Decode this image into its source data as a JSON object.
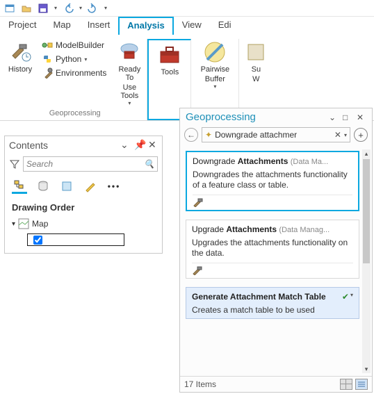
{
  "qat": {
    "items": [
      "new-project",
      "open",
      "save",
      "undo",
      "redo"
    ]
  },
  "ribbon": {
    "tabs": [
      {
        "id": "project",
        "label": "Project"
      },
      {
        "id": "map",
        "label": "Map"
      },
      {
        "id": "insert",
        "label": "Insert"
      },
      {
        "id": "analysis",
        "label": "Analysis",
        "active": true
      },
      {
        "id": "view",
        "label": "View"
      },
      {
        "id": "edit",
        "label": "Edi"
      }
    ],
    "group_label": "Geoprocessing",
    "history_label": "History",
    "modelbuilder_label": "ModelBuilder",
    "python_label": "Python",
    "environments_label": "Environments",
    "ready_label_line1": "Ready To",
    "ready_label_line2": "Use Tools",
    "tools_label": "Tools",
    "pairwise_line1": "Pairwise",
    "pairwise_line2": "Buffer",
    "sum_line1": "Su",
    "sum_line2": "W"
  },
  "contents": {
    "title": "Contents",
    "search_placeholder": "Search",
    "section": "Drawing Order",
    "map_label": "Map"
  },
  "gp": {
    "title": "Geoprocessing",
    "search_text": "Downgrade attachmer",
    "results": [
      {
        "title_prefix": "Downgrade ",
        "title_bold": "Attachments",
        "category": "(Data Ma...",
        "desc": "Downgrades the attachments functionality of a feature class or table.",
        "highlight": true
      },
      {
        "title_prefix": "Upgrade ",
        "title_bold": "Attachments",
        "category": "(Data Manag...",
        "desc": "Upgrades the attachments functionality on the data."
      },
      {
        "title_prefix": "",
        "title_bold": "Generate Attachment Match Table",
        "category": "",
        "desc": "Creates a match table to be used",
        "selected": true,
        "checked": true
      }
    ],
    "count_label": "17 Items"
  }
}
